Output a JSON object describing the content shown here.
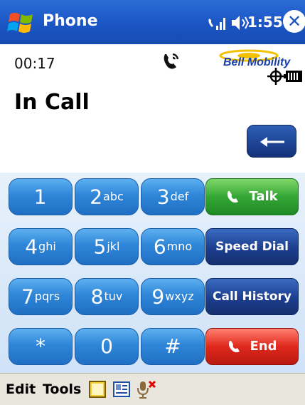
{
  "titlebar": {
    "app_title": "Phone",
    "clock": "1:55",
    "close_label": "✕"
  },
  "call": {
    "timer": "00:17",
    "status": "In Call",
    "operator": "Bell Mobility"
  },
  "keypad": {
    "keys": [
      {
        "digit": "1",
        "letters": ""
      },
      {
        "digit": "2",
        "letters": "abc"
      },
      {
        "digit": "3",
        "letters": "def"
      },
      {
        "digit": "4",
        "letters": "ghi"
      },
      {
        "digit": "5",
        "letters": "jkl"
      },
      {
        "digit": "6",
        "letters": "mno"
      },
      {
        "digit": "7",
        "letters": "pqrs"
      },
      {
        "digit": "8",
        "letters": "tuv"
      },
      {
        "digit": "9",
        "letters": "wxyz"
      },
      {
        "digit": "*",
        "letters": ""
      },
      {
        "digit": "0",
        "letters": ""
      },
      {
        "digit": "#",
        "letters": ""
      }
    ],
    "talk_label": "Talk",
    "speed_dial_label": "Speed Dial",
    "call_history_label": "Call History",
    "end_label": "End"
  },
  "menubar": {
    "edit_label": "Edit",
    "tools_label": "Tools"
  },
  "icons": {
    "start": "windows-flag-icon",
    "signal": "phone-signal-icon",
    "speaker": "speaker-volume-icon",
    "close": "close-icon",
    "handset": "call-handset-icon",
    "gps": "gps-icon",
    "battery": "battery-icon",
    "backspace": "arrow-left-icon",
    "note": "note-icon",
    "contact": "contact-card-icon",
    "mic": "microphone-off-icon"
  },
  "colors": {
    "titlebar": "#1b55c4",
    "key_blue": "#2f86d8",
    "talk_green": "#34a635",
    "navy": "#1c3e8e",
    "end_red": "#e0281c",
    "menubar": "#e9e6dd"
  }
}
